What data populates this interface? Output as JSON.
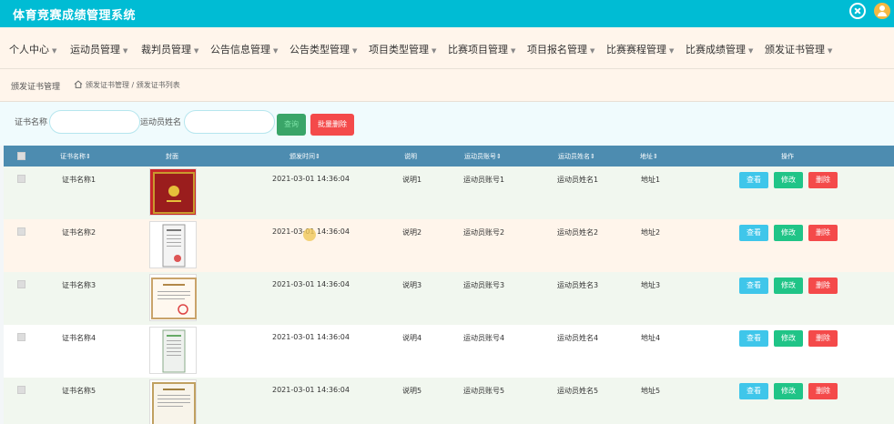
{
  "app": {
    "title": "体育竞赛成绩管理系统"
  },
  "nav": [
    {
      "label": "个人中心"
    },
    {
      "label": "运动员管理"
    },
    {
      "label": "裁判员管理"
    },
    {
      "label": "公告信息管理"
    },
    {
      "label": "公告类型管理"
    },
    {
      "label": "项目类型管理"
    },
    {
      "label": "比赛项目管理"
    },
    {
      "label": "项目报名管理"
    },
    {
      "label": "比赛赛程管理"
    },
    {
      "label": "比赛成绩管理"
    },
    {
      "label": "颁发证书管理"
    }
  ],
  "breadcrumb": {
    "title": "颁发证书管理",
    "path": "颁发证书管理 / 颁发证书列表"
  },
  "search": {
    "label1": "证书名称",
    "input1_value": "",
    "input1_placeholder": "",
    "label2": "运动员姓名",
    "input2_value": "",
    "input2_placeholder": "",
    "search_button": "查询",
    "batch_delete_button": "批量删除"
  },
  "table": {
    "headers": [
      "证书名称",
      "封面",
      "颁发时间",
      "说明",
      "运动员账号",
      "运动员姓名",
      "地址",
      "操作"
    ],
    "actions": {
      "view": "查看",
      "edit": "修改",
      "delete": "删除"
    },
    "rows": [
      {
        "name": "证书名称1",
        "time": "2021-03-01 14:36:04",
        "desc": "说明1",
        "account": "运动员账号1",
        "athlete": "运动员姓名1",
        "address": "地址1"
      },
      {
        "name": "证书名称2",
        "time": "2021-03-01 14:36:04",
        "desc": "说明2",
        "account": "运动员账号2",
        "athlete": "运动员姓名2",
        "address": "地址2"
      },
      {
        "name": "证书名称3",
        "time": "2021-03-01 14:36:04",
        "desc": "说明3",
        "account": "运动员账号3",
        "athlete": "运动员姓名3",
        "address": "地址3"
      },
      {
        "name": "证书名称4",
        "time": "2021-03-01 14:36:04",
        "desc": "说明4",
        "account": "运动员账号4",
        "athlete": "运动员姓名4",
        "address": "地址4"
      },
      {
        "name": "证书名称5",
        "time": "2021-03-01 14:36:04",
        "desc": "说明5",
        "account": "运动员账号5",
        "athlete": "运动员姓名5",
        "address": "地址5"
      }
    ]
  },
  "colors": {
    "topbar": "#00bcd4",
    "nav_bg": "#fff5eb",
    "table_header": "#4d8cb0",
    "row_even": "#f1f7ef",
    "row_odd": "#fff5eb",
    "view": "#3fc6ea",
    "edit": "#20c487",
    "delete": "#f44a4a"
  }
}
